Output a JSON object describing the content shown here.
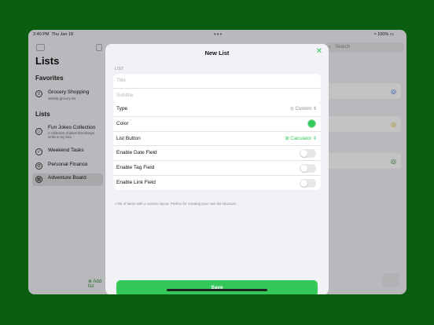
{
  "status": {
    "time": "2:40 PM",
    "date": "Thu Jan 18",
    "dots": "•••",
    "battery": "100%"
  },
  "sidebar": {
    "title": "Lists",
    "favorites_header": "Favorites",
    "favorites": [
      {
        "label": "Grocery Shopping",
        "subtitle": "Weekly grocery list"
      }
    ],
    "lists_header": "Lists",
    "lists": [
      {
        "label": "Fun Jokes Collection",
        "subtitle": "A collection of jokes that always smile to my face"
      },
      {
        "label": "Weekend Tasks"
      },
      {
        "label": "Personal Finance"
      },
      {
        "label": "Adventure Board"
      }
    ],
    "add_list": "Add list"
  },
  "search": {
    "placeholder": "Search"
  },
  "modal": {
    "title": "New List",
    "section_header": "LIST",
    "title_placeholder": "Title",
    "subtitle_placeholder": "Subtitle",
    "rows": {
      "type_label": "Type",
      "type_value": "Custom",
      "color_label": "Color",
      "color_value": "#34c759",
      "button_label": "List Button",
      "button_value": "Calculator",
      "date_label": "Enable Date Field",
      "tag_label": "Enable Tag Field",
      "link_label": "Enable Link Field"
    },
    "footnote": "A list of items with a custom layout. Perfect for creating your own list structure.",
    "save_label": "Save"
  },
  "colors": {
    "accent": "#34c759",
    "background": "#0b5e10"
  }
}
